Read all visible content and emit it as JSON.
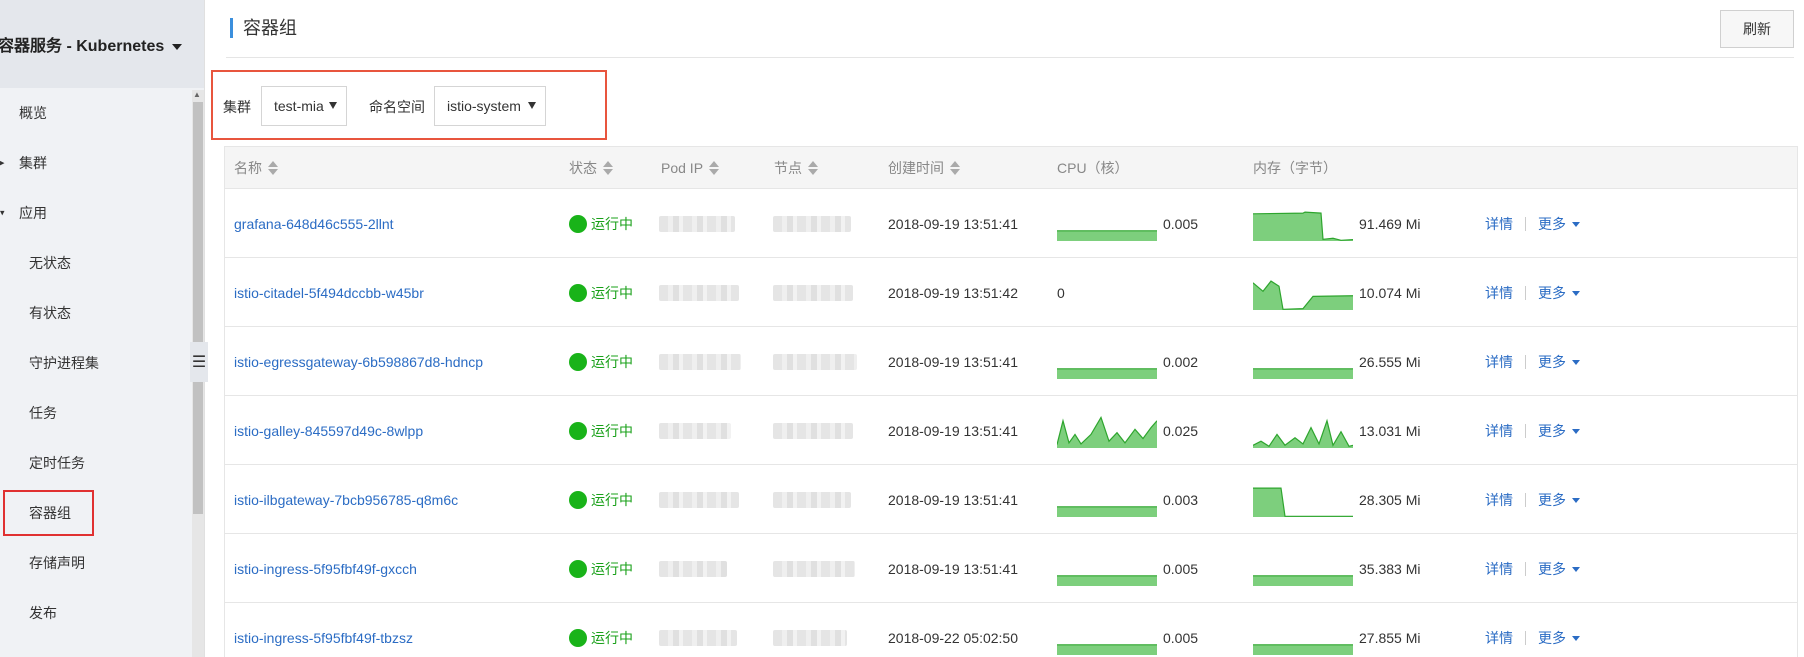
{
  "sidebar": {
    "title": "容器服务 - Kubernetes",
    "items": [
      {
        "label": "概览",
        "level": 1,
        "arrow": ""
      },
      {
        "label": "集群",
        "level": 1,
        "arrow": "▸"
      },
      {
        "label": "应用",
        "level": 1,
        "arrow": "▾"
      },
      {
        "label": "无状态",
        "level": 2
      },
      {
        "label": "有状态",
        "level": 2
      },
      {
        "label": "守护进程集",
        "level": 2
      },
      {
        "label": "任务",
        "level": 2
      },
      {
        "label": "定时任务",
        "level": 2
      },
      {
        "label": "容器组",
        "level": 2,
        "active": true
      },
      {
        "label": "存储声明",
        "level": 2
      },
      {
        "label": "发布",
        "level": 2
      }
    ]
  },
  "header": {
    "title": "容器组",
    "refresh_label": "刷新"
  },
  "filters": {
    "cluster_label": "集群",
    "cluster_value": "test-mia",
    "namespace_label": "命名空间",
    "namespace_value": "istio-system"
  },
  "table": {
    "columns": [
      "名称",
      "状态",
      "Pod IP",
      "节点",
      "创建时间",
      "CPU（核）",
      "内存（字节）"
    ],
    "detail_label": "详情",
    "more_label": "更多",
    "rows": [
      {
        "name": "grafana-648d46c555-2llnt",
        "status": "运行中",
        "created": "2018-09-19 13:51:41",
        "cpu": "0.005",
        "cpu_chart": "flat",
        "mem": "91.469 Mi",
        "mem_chart": "high-drop"
      },
      {
        "name": "istio-citadel-5f494dccbb-w45br",
        "status": "运行中",
        "created": "2018-09-19 13:51:42",
        "cpu": "0",
        "cpu_chart": "none",
        "mem": "10.074 Mi",
        "mem_chart": "dip"
      },
      {
        "name": "istio-egressgateway-6b598867d8-hdncp",
        "status": "运行中",
        "created": "2018-09-19 13:51:41",
        "cpu": "0.002",
        "cpu_chart": "flat",
        "mem": "26.555 Mi",
        "mem_chart": "flat"
      },
      {
        "name": "istio-galley-845597d49c-8wlpp",
        "status": "运行中",
        "created": "2018-09-19 13:51:41",
        "cpu": "0.025",
        "cpu_chart": "spiky",
        "mem": "13.031 Mi",
        "mem_chart": "spiky-small"
      },
      {
        "name": "istio-ilbgateway-7bcb956785-q8m6c",
        "status": "运行中",
        "created": "2018-09-19 13:51:41",
        "cpu": "0.003",
        "cpu_chart": "flat",
        "mem": "28.305 Mi",
        "mem_chart": "block-drop"
      },
      {
        "name": "istio-ingress-5f95fbf49f-gxcch",
        "status": "运行中",
        "created": "2018-09-19 13:51:41",
        "cpu": "0.005",
        "cpu_chart": "flat",
        "mem": "35.383 Mi",
        "mem_chart": "flat"
      },
      {
        "name": "istio-ingress-5f95fbf49f-tbzsz",
        "status": "运行中",
        "created": "2018-09-22 05:02:50",
        "cpu": "0.005",
        "cpu_chart": "flat",
        "mem": "27.855 Mi",
        "mem_chart": "flat"
      }
    ]
  },
  "colors": {
    "accent": "#2b6cc4",
    "running": "#19b319",
    "highlight": "#e8553e",
    "spark_fill": "#7dcf7d",
    "spark_line": "#2ea52e"
  }
}
